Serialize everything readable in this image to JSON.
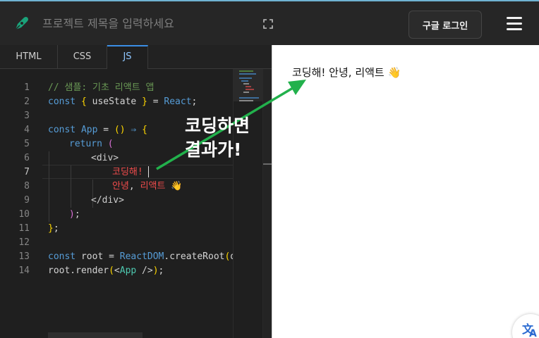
{
  "header": {
    "title_placeholder": "프로젝트 제목을 입력하세요",
    "login_label": "구글 로그인"
  },
  "tabs": [
    {
      "label": "HTML"
    },
    {
      "label": "CSS"
    },
    {
      "label": "JS",
      "active": true
    }
  ],
  "editor": {
    "line_numbers": [
      "1",
      "2",
      "3",
      "4",
      "5",
      "6",
      "7",
      "8",
      "9",
      "10",
      "11",
      "12",
      "13",
      "14"
    ],
    "active_line": "7",
    "code": {
      "l1_comment": "// 샘플: 기초 리액트 앱",
      "l2_const": "const",
      "l2_brace_open": "{",
      "l2_name": " useState ",
      "l2_brace_close": "}",
      "l2_eq": " = ",
      "l2_react": "React",
      "l2_semi": ";",
      "l4_const": "const",
      "l4_app": "App",
      "l4_eq": " = ",
      "l4_parens": "()",
      "l4_arrow": " ⇒ ",
      "l4_brace": "{",
      "l5_return": "return",
      "l5_paren": "(",
      "l6_tag": "<div>",
      "l7_text": "코딩해!",
      "l8_text1": "안녕",
      "l8_comma": ", ",
      "l8_text2": "리액트",
      "l8_emoji": "👋",
      "l9_tag": "</div>",
      "l10_paren": ")",
      "l10_semi": ";",
      "l11_brace": "}",
      "l11_semi": ";",
      "l13_const": "const",
      "l13_rest": " root = ",
      "l13_reactdom": "ReactDOM",
      "l13_create": ".createRoot",
      "l13_paren": "(",
      "l13_tail": "do",
      "l14_root": "root.render",
      "l14_paren_open": "(",
      "l14_tag_open": "<",
      "l14_app": "App",
      "l14_tag_close": " />",
      "l14_paren_close": ")",
      "l14_semi": ";"
    }
  },
  "annotation": {
    "line1": "코딩하면",
    "line2": "결과가!"
  },
  "preview": {
    "text": "코딩해! 안녕, 리액트 👋"
  },
  "icons": {
    "logo": "pen-nib-icon",
    "expand": "fullscreen-icon",
    "menu": "hamburger-menu-icon",
    "translate": "translate-icon"
  },
  "colors": {
    "topbar": "#262626",
    "accent_tab": "#3a8ee6",
    "logo_green": "#1aa37a",
    "arrow_green": "#22b14c",
    "string_red": "#f14c4c"
  }
}
